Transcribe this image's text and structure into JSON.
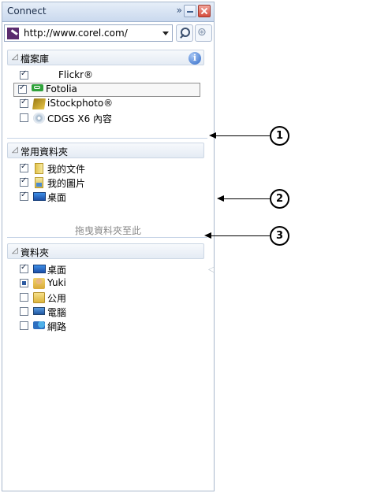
{
  "window": {
    "title": "Connect",
    "overflow_glyph": "»"
  },
  "urlbar": {
    "value": "http://www.corel.com/"
  },
  "sections": {
    "libraries": {
      "label": "檔案庫",
      "info_glyph": "i",
      "items": [
        {
          "label": "Flickr®",
          "checked": true,
          "icon": "flickr-icon"
        },
        {
          "label": "Fotolia",
          "checked": true,
          "icon": "fotolia-icon",
          "highlighted": true
        },
        {
          "label": "iStockphoto®",
          "checked": true,
          "icon": "istockphoto-icon"
        },
        {
          "label": "CDGS X6 內容",
          "checked": false,
          "icon": "cd-content-icon"
        }
      ]
    },
    "favorites": {
      "label": "常用資料夾",
      "items": [
        {
          "label": "我的文件",
          "checked": true,
          "icon": "documents-folder-icon"
        },
        {
          "label": "我的圖片",
          "checked": true,
          "icon": "pictures-folder-icon"
        },
        {
          "label": "桌面",
          "checked": true,
          "icon": "desktop-icon"
        }
      ],
      "drop_hint": "拖曳資料夾至此"
    },
    "folders": {
      "label": "資料夾",
      "items": [
        {
          "label": "桌面",
          "checked": true,
          "icon": "desktop-icon"
        },
        {
          "label": "Yuki",
          "checked": "partial",
          "icon": "user-folder-icon"
        },
        {
          "label": "公用",
          "checked": false,
          "icon": "folder-icon"
        },
        {
          "label": "電腦",
          "checked": false,
          "icon": "computer-icon"
        },
        {
          "label": "網路",
          "checked": false,
          "icon": "network-icon"
        }
      ]
    }
  },
  "callouts": [
    "1",
    "2",
    "3"
  ]
}
